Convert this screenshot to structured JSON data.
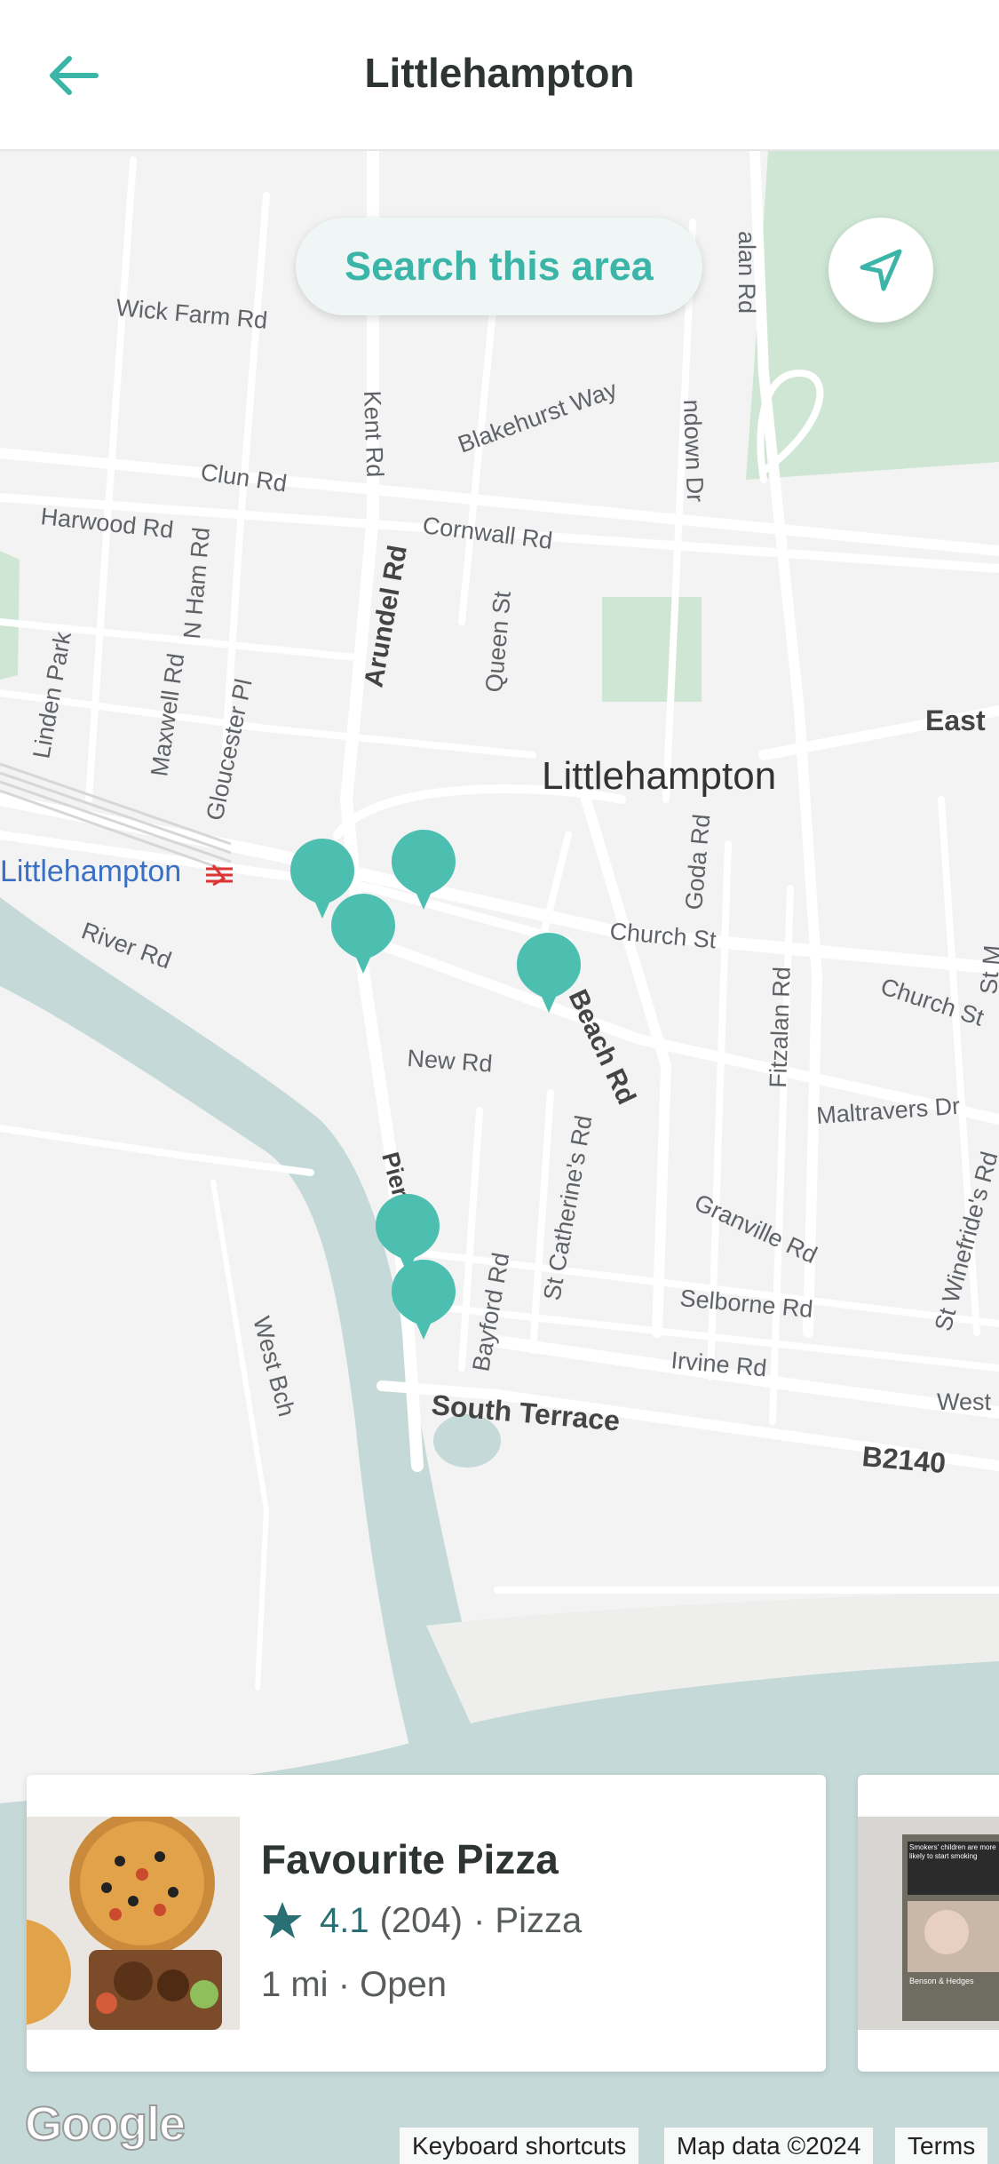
{
  "header": {
    "title": "Littlehampton",
    "back_icon": "arrow-left-icon"
  },
  "map": {
    "search_button": "Search this area",
    "locate_icon": "navigation-arrow-icon",
    "town_label": "Littlehampton",
    "station_label": "Littlehampton",
    "street_labels": {
      "wick_farm": "Wick Farm Rd",
      "kent": "Kent Rd",
      "blakehurst": "Blakehurst Way",
      "clun": "Clun Rd",
      "harwood": "Harwood Rd",
      "n_ham": "N Ham Rd",
      "cornwall": "Cornwall Rd",
      "arundel": "Arundel Rd",
      "queen": "Queen St",
      "linden": "Linden Park",
      "maxwell": "Maxwell Rd",
      "gloucester": "Gloucester Pl",
      "goda": "Goda Rd",
      "church1": "Church St",
      "church2": "Church St",
      "river": "River Rd",
      "beach1": "Beach Rd",
      "beach2": "Beach Rd",
      "new": "New Rd",
      "fitzalan": "Fitzalan Rd",
      "maltravers": "Maltravers Dr",
      "pier": "Pier Rd",
      "st_catherine": "St Catherine's Rd",
      "granville": "Granville Rd",
      "selborne": "Selborne Rd",
      "bayford": "Bayford Rd",
      "irvine": "Irvine Rd",
      "west_bch": "West Bch",
      "south_terrace": "South Terrace",
      "b2140": "B2140",
      "east": "East",
      "west": "West",
      "alan": "alan Rd",
      "ndown": "ndown Dr",
      "st_winefride": "St Winefride's Rd",
      "st_m": "St M"
    },
    "pins_count": 6,
    "accent_color": "#4cbfb1"
  },
  "cards": [
    {
      "name": "Favourite Pizza",
      "rating": "4.1",
      "reviews": "(204)",
      "cuisine": "· Pizza",
      "distance": "1 mi",
      "status": "· Open"
    },
    {
      "image_caption": "Smokers' children are more likely to start smoking",
      "brand": "Benson & Hedges"
    }
  ],
  "attribution": {
    "logo": "Google",
    "keyboard": "Keyboard shortcuts",
    "map_data": "Map data ©2024",
    "terms": "Terms"
  }
}
